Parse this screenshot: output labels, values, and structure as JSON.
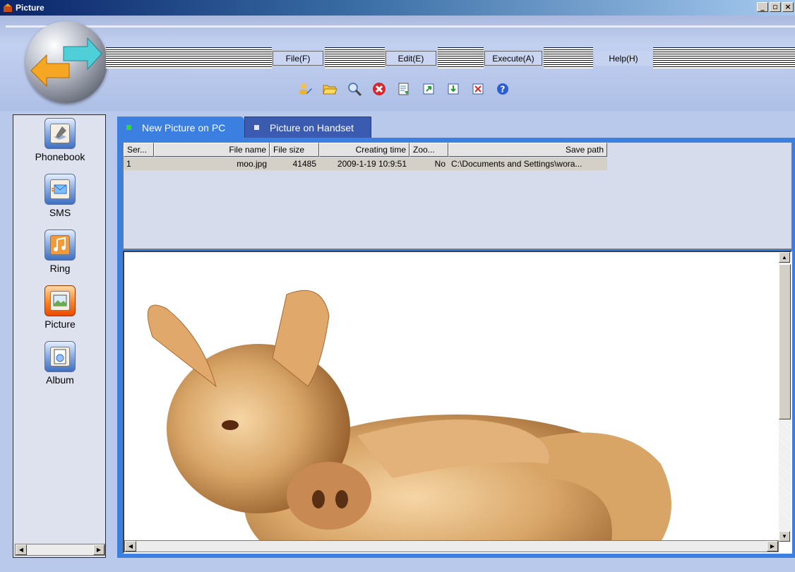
{
  "window": {
    "title": "Picture"
  },
  "menu": {
    "file": "File(F)",
    "edit": "Edit(E)",
    "execute": "Execute(A)",
    "help": "Help(H)"
  },
  "toolbar_icons": [
    "user-edit-icon",
    "folder-open-icon",
    "search-icon",
    "delete-icon",
    "document-icon",
    "export-icon",
    "import-icon",
    "remove-icon",
    "help-icon"
  ],
  "sidebar": {
    "items": [
      {
        "label": "Phonebook",
        "icon": "phonebook-icon"
      },
      {
        "label": "SMS",
        "icon": "sms-icon"
      },
      {
        "label": "Ring",
        "icon": "ring-icon"
      },
      {
        "label": "Picture",
        "icon": "picture-icon",
        "active": true
      },
      {
        "label": "Album",
        "icon": "album-icon"
      }
    ]
  },
  "tabs": {
    "pc": "New Picture on PC",
    "handset": "Picture on Handset"
  },
  "table": {
    "headers": [
      "Ser...",
      "File name",
      "File size",
      "Creating time",
      "Zoo...",
      "Save path"
    ],
    "rows": [
      [
        "1",
        "moo.jpg",
        "41485",
        "2009-1-19 10:9:51",
        "No",
        "C:\\Documents and Settings\\wora..."
      ]
    ]
  },
  "colors": {
    "active_tab": "#3b7fe0",
    "inactive_tab": "#3b5bb0",
    "active_nav": "#ff8a2a"
  }
}
